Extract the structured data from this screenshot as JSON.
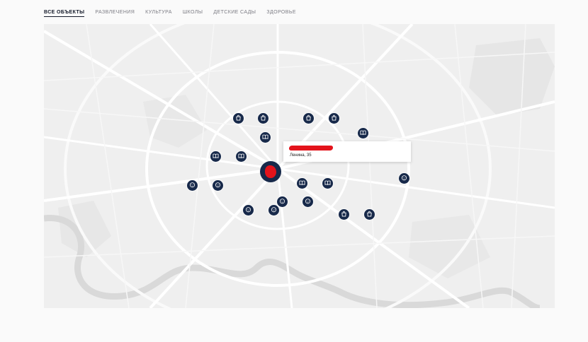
{
  "tabs": [
    {
      "label": "ВСЕ ОБЪЕКТЫ",
      "active": true
    },
    {
      "label": "РАЗВЛЕЧЕНИЯ",
      "active": false
    },
    {
      "label": "КУЛЬТУРА",
      "active": false
    },
    {
      "label": "ШКОЛЫ",
      "active": false
    },
    {
      "label": "ДЕТСКИЕ САДЫ",
      "active": false
    },
    {
      "label": "ЗДОРОВЬЕ",
      "active": false
    }
  ],
  "popup": {
    "address": "Ленина, 35"
  },
  "markers": [
    {
      "icon": "bag-icon"
    },
    {
      "icon": "bag-icon"
    },
    {
      "icon": "bag-icon"
    },
    {
      "icon": "bag-icon"
    },
    {
      "icon": "book-icon"
    },
    {
      "icon": "book-icon"
    },
    {
      "icon": "book-icon"
    },
    {
      "icon": "book-icon"
    },
    {
      "icon": "book-icon"
    },
    {
      "icon": "book-icon"
    },
    {
      "icon": "baby-icon"
    },
    {
      "icon": "baby-icon"
    },
    {
      "icon": "baby-icon"
    },
    {
      "icon": "baby-icon"
    },
    {
      "icon": "baby-icon"
    },
    {
      "icon": "baby-icon"
    },
    {
      "icon": "baby-icon"
    },
    {
      "icon": "bag-icon"
    },
    {
      "icon": "bag-icon"
    }
  ],
  "colors": {
    "marker": "#17294a",
    "redaction": "#e3131b",
    "map_bg": "#eeeeee",
    "road": "#ffffff",
    "river": "#d9d9d9"
  }
}
